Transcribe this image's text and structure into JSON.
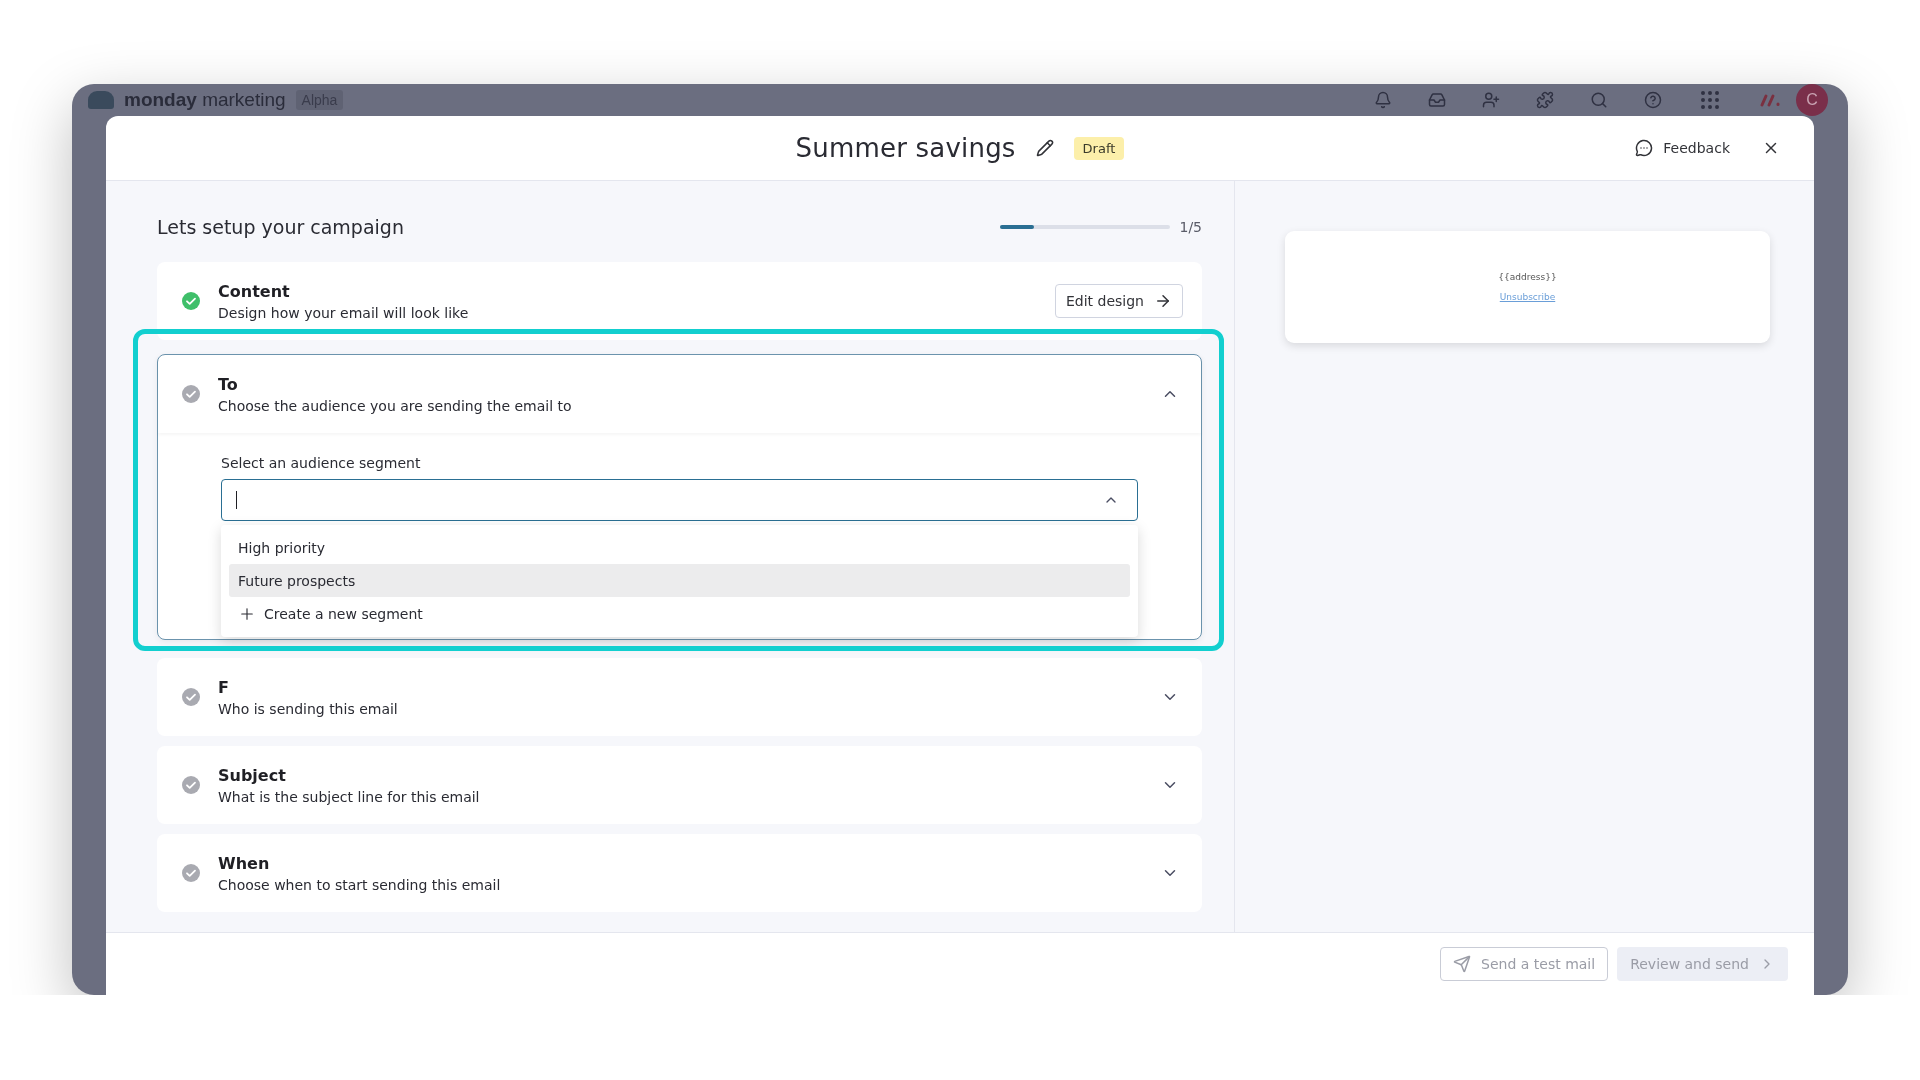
{
  "app_bar": {
    "brand": "monday",
    "product": "marketing",
    "tag": "Alpha",
    "avatar": "C"
  },
  "modal": {
    "title": "Summer savings",
    "status": "Draft",
    "feedback": "Feedback"
  },
  "setup": {
    "heading": "Lets setup your campaign",
    "progress": {
      "level": 0.2,
      "reading": "1/5"
    }
  },
  "sections": [
    {
      "title": "Content",
      "subtitle": "Design how your email will look like",
      "done": true,
      "expanded": false,
      "highlighted": false,
      "action": "Edit design"
    },
    {
      "title": "To",
      "subtitle": "Choose the audience you are sending the email to",
      "done": false,
      "expanded": true,
      "highlighted": true,
      "field": {
        "label": "Select an audience segment",
        "open": true,
        "options": [
          {
            "label": "High priority",
            "selected": false
          },
          {
            "label": "Future prospects",
            "selected": true
          }
        ],
        "create": "Create a new segment"
      }
    },
    {
      "title": "F",
      "subtitle": "Who is sending this email",
      "done": false,
      "expanded": false,
      "highlighted": false
    },
    {
      "title": "Subject",
      "subtitle": "What is the subject line for this email",
      "done": false,
      "expanded": false,
      "highlighted": false
    },
    {
      "title": "When",
      "subtitle": "Choose when to start sending this email",
      "done": false,
      "expanded": false,
      "highlighted": false
    }
  ],
  "preview": {
    "address": "{{address}}",
    "link": "Unsubscribe"
  },
  "footer": {
    "buttons": [
      {
        "label": "Send a test mail",
        "kind": "outline",
        "disabled": true
      },
      {
        "label": "Review and send",
        "kind": "filled",
        "disabled": true
      }
    ]
  }
}
